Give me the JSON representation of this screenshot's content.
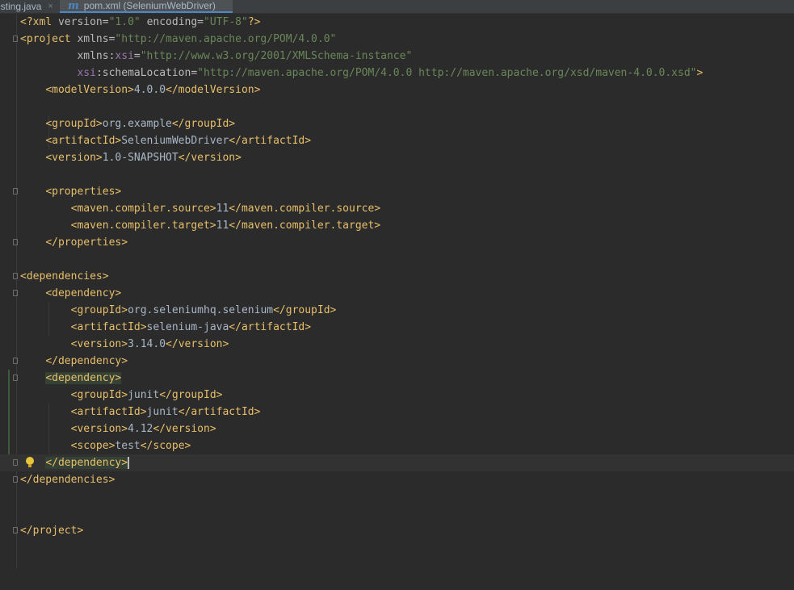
{
  "tabs": [
    {
      "label": "esting.java",
      "close": "×"
    },
    {
      "label": "pom.xml (SeleniumWebDriver)",
      "icon": "m"
    }
  ],
  "code": {
    "l1": [
      "<?xml version=\"1.0\" encoding=\"UTF-8\"?>"
    ],
    "xml_decl_open": "<?xml ",
    "xml_version_attr": "version=",
    "xml_version_val": "\"1.0\"",
    "xml_encoding_attr": "encoding=",
    "xml_encoding_val": "\"UTF-8\"",
    "xml_decl_close": "?>",
    "project_open": "<project ",
    "xmlns_attr": "xmlns=",
    "xmlns_val": "\"http://maven.apache.org/POM/4.0.0\"",
    "xmlns_xsi_prefix": "xmlns:",
    "xmlns_xsi_ns": "xsi",
    "xmlns_xsi_eq": "=",
    "xmlns_xsi_val": "\"http://www.w3.org/2001/XMLSchema-instance\"",
    "schema_ns": "xsi",
    "schema_attr": ":schemaLocation=",
    "schema_val": "\"http://maven.apache.org/POM/4.0.0 http://maven.apache.org/xsd/maven-4.0.0.xsd\"",
    "project_gt": ">",
    "modelVersion_open": "<modelVersion>",
    "modelVersion_val": "4.0.0",
    "modelVersion_close": "</modelVersion>",
    "groupId_open": "<groupId>",
    "groupId_val": "org.example",
    "groupId_close": "</groupId>",
    "artifactId_open": "<artifactId>",
    "artifactId_val": "SeleniumWebDriver",
    "artifactId_close": "</artifactId>",
    "version_open": "<version>",
    "version_val": "1.0-SNAPSHOT",
    "version_close": "</version>",
    "properties_open": "<properties>",
    "mcs_open": "<maven.compiler.source>",
    "mcs_val": "11",
    "mcs_close": "</maven.compiler.source>",
    "mct_open": "<maven.compiler.target>",
    "mct_val": "11",
    "mct_close": "</maven.compiler.target>",
    "properties_close": "</properties>",
    "dependencies_open": "<dependencies>",
    "dependency_open": "<dependency>",
    "dep1_groupId_val": "org.seleniumhq.selenium",
    "dep1_artifactId_val": "selenium-java",
    "dep1_version_val": "3.14.0",
    "dependency_close": "</dependency>",
    "dep2_groupId_val": "junit",
    "dep2_artifactId_val": "junit",
    "dep2_version_val": "4.12",
    "scope_open": "<scope>",
    "scope_val": "test",
    "scope_close": "</scope>",
    "dependencies_close": "</dependencies>",
    "project_close": "</project>"
  },
  "colors": {
    "background": "#2b2b2b",
    "tag": "#e8bf6a",
    "string": "#6a8759",
    "namespace": "#9876aa",
    "text": "#a9b7c6"
  },
  "icons": [
    "close-icon",
    "maven-file-icon",
    "fold-icon",
    "lightbulb-icon"
  ]
}
